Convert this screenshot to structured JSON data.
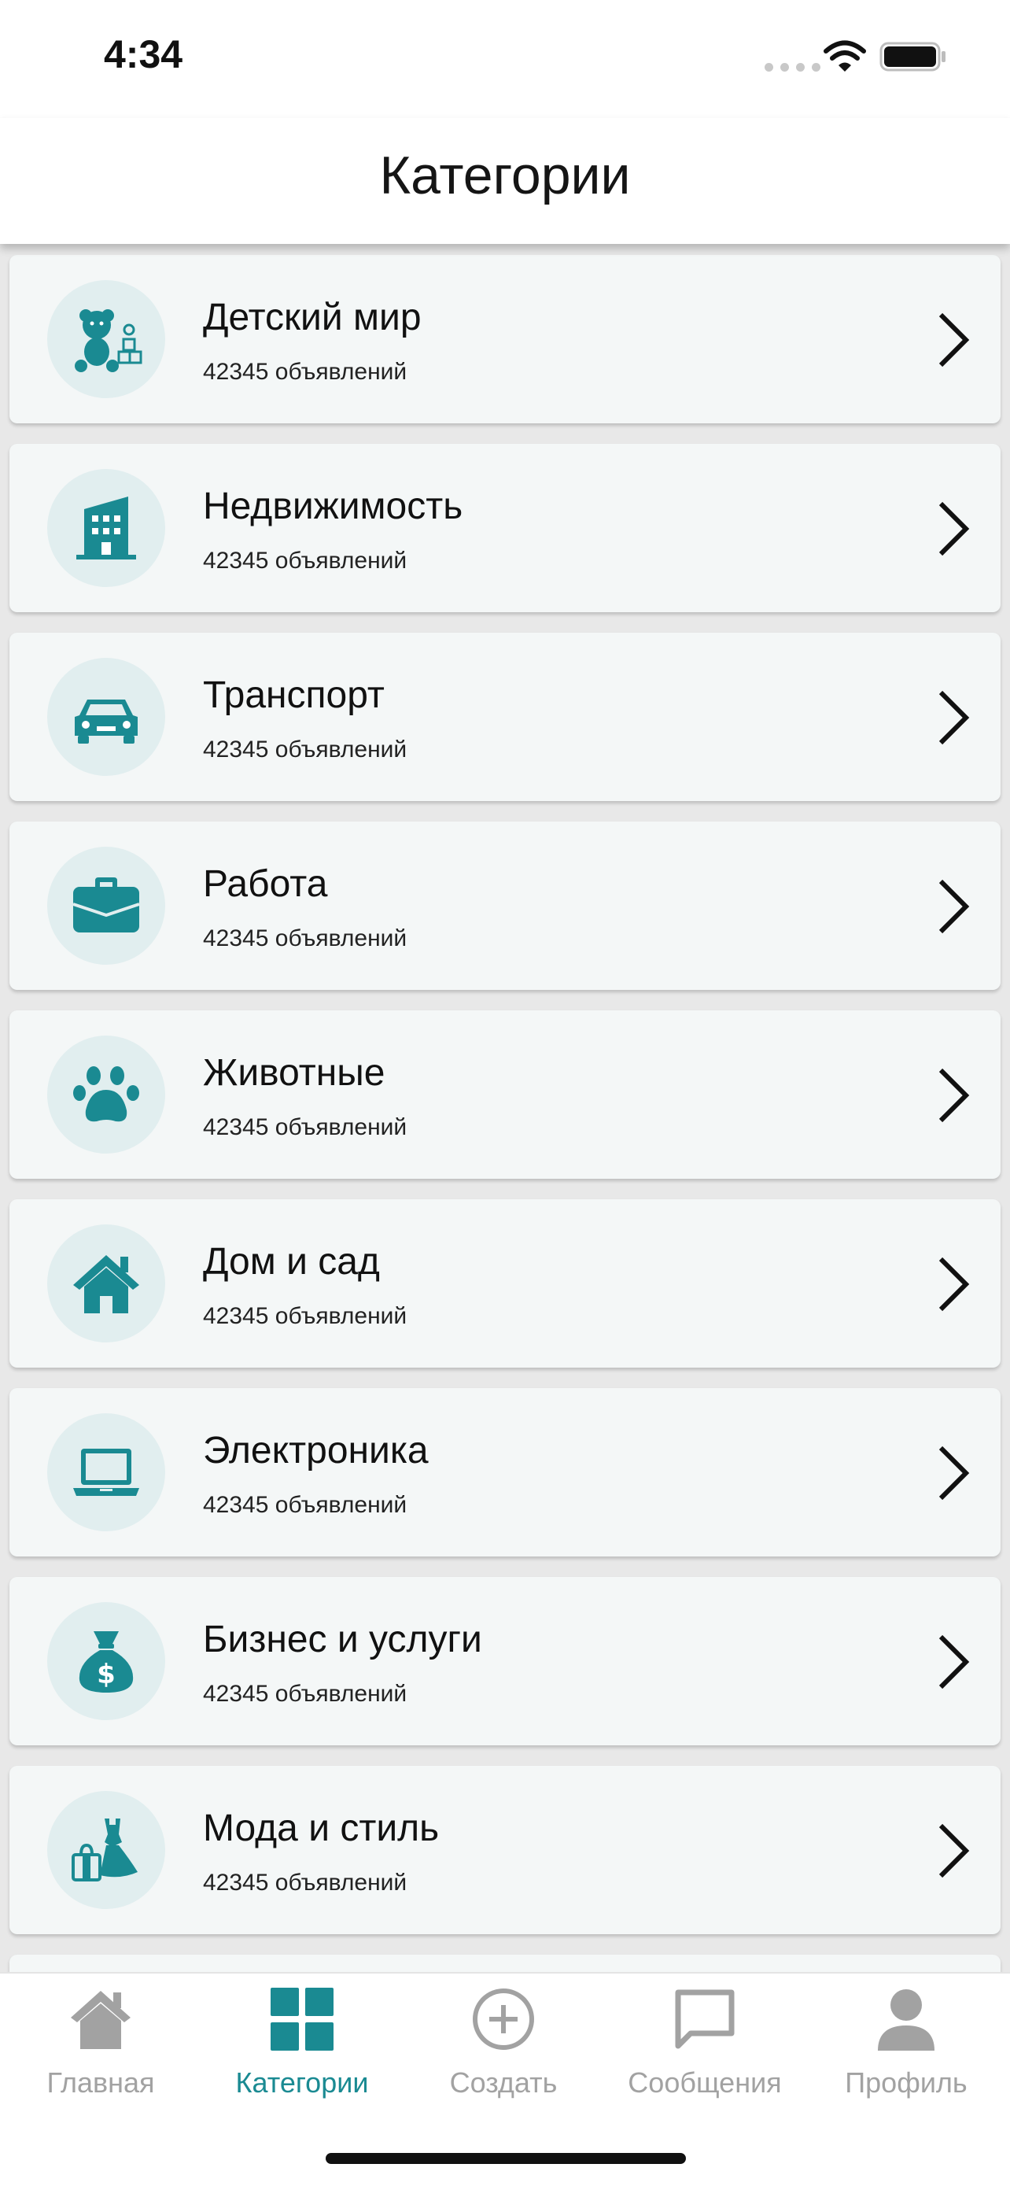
{
  "status_bar": {
    "time": "4:34"
  },
  "header": {
    "title": "Категории"
  },
  "categories": [
    {
      "title": "Детский мир",
      "count": "42345 объявлений",
      "icon": "teddy-bear-icon"
    },
    {
      "title": "Недвижимость",
      "count": "42345 объявлений",
      "icon": "building-icon"
    },
    {
      "title": "Транспорт",
      "count": "42345 объявлений",
      "icon": "car-icon"
    },
    {
      "title": "Работа",
      "count": "42345 объявлений",
      "icon": "briefcase-icon"
    },
    {
      "title": "Животные",
      "count": "42345 объявлений",
      "icon": "paw-icon"
    },
    {
      "title": "Дом и сад",
      "count": "42345 объявлений",
      "icon": "house-icon"
    },
    {
      "title": "Электроника",
      "count": "42345 объявлений",
      "icon": "laptop-icon"
    },
    {
      "title": "Бизнес и услуги",
      "count": "42345 объявлений",
      "icon": "money-bag-icon"
    },
    {
      "title": "Мода и стиль",
      "count": "42345 объявлений",
      "icon": "dress-icon"
    }
  ],
  "tabbar": {
    "tabs": [
      {
        "label": "Главная",
        "icon": "home-icon",
        "active": false
      },
      {
        "label": "Категории",
        "icon": "grid-icon",
        "active": true
      },
      {
        "label": "Создать",
        "icon": "plus-circle-icon",
        "active": false
      },
      {
        "label": "Сообщения",
        "icon": "chat-icon",
        "active": false
      },
      {
        "label": "Профиль",
        "icon": "user-icon",
        "active": false
      }
    ]
  },
  "colors": {
    "accent": "#1a8a92",
    "inactive": "#a2a2a2",
    "icon_bg": "#e1eeef",
    "card_bg": "#f4f7f7"
  }
}
